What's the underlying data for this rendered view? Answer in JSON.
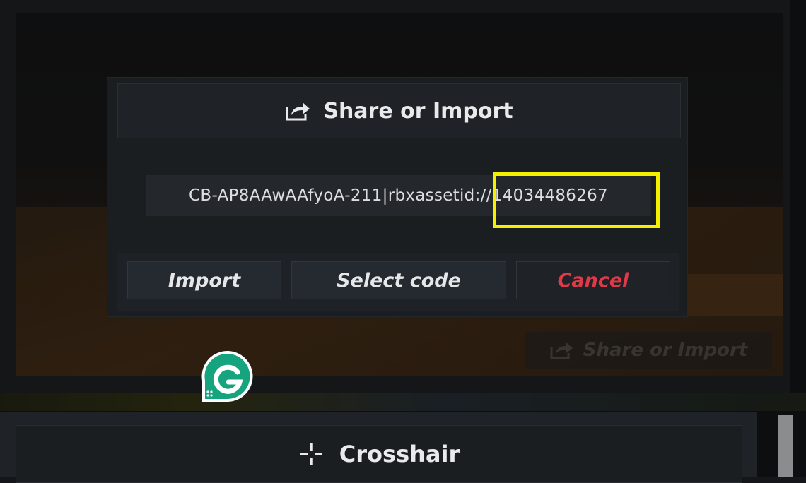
{
  "modal": {
    "title": "Share or Import",
    "title_icon": "share-icon",
    "code_value": "CB-AP8AAwAAfyoA-211|rbxassetid://14034486267",
    "buttons": {
      "import": "Import",
      "select_code": "Select code",
      "cancel": "Cancel"
    }
  },
  "background": {
    "share_button_label": "Share or Import",
    "share_button_icon": "share-icon"
  },
  "crosshair_section": {
    "title": "Crosshair",
    "icon": "crosshair-icon"
  },
  "badge": {
    "letter": "G",
    "icon": "grammarly-icon"
  },
  "colors": {
    "highlight": "#f5f000",
    "cancel_text": "#e03a48",
    "badge_green": "#15a47e"
  }
}
